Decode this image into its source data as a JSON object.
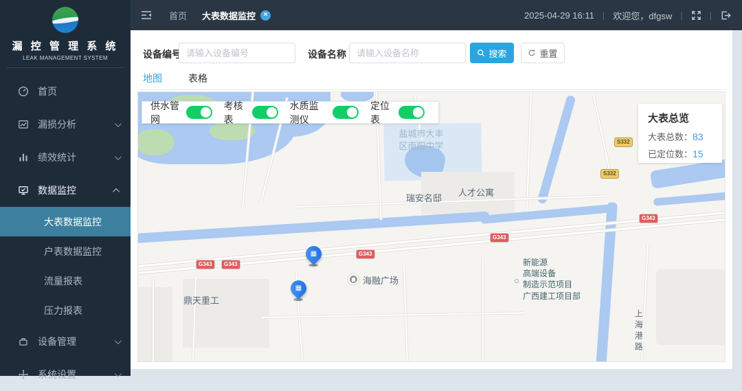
{
  "app": {
    "title": "漏 控 管 理 系 统",
    "subtitle": "LEAK MANAGEMENT SYSTEM"
  },
  "sidebar": {
    "items": [
      {
        "label": "首页"
      },
      {
        "label": "漏损分析"
      },
      {
        "label": "绩效统计"
      },
      {
        "label": "数据监控"
      },
      {
        "label": "设备管理"
      },
      {
        "label": "系统设置"
      }
    ],
    "submenu": [
      {
        "label": "大表数据监控",
        "active": true
      },
      {
        "label": "户表数据监控"
      },
      {
        "label": "流量报表"
      },
      {
        "label": "压力报表"
      }
    ]
  },
  "header": {
    "tabs": [
      {
        "label": "首页"
      },
      {
        "label": "大表数据监控",
        "active": true
      }
    ],
    "close_x": "×",
    "datetime": "2025-04-29 16:11",
    "welcome": "欢迎您，dfgsw",
    "sep": "|"
  },
  "search": {
    "fields": [
      {
        "label": "设备编号",
        "placeholder": "请输入设备编号"
      },
      {
        "label": "设备名称",
        "placeholder": "请输入设备名称"
      }
    ],
    "search_label": "搜索",
    "reset_label": "重置"
  },
  "view_tabs": [
    {
      "label": "地图",
      "active": true
    },
    {
      "label": "表格"
    }
  ],
  "map": {
    "toggles": [
      {
        "label": "供水管网",
        "on": true
      },
      {
        "label": "考核表",
        "on": true
      },
      {
        "label": "水质监测仪",
        "on": true
      },
      {
        "label": "定位表",
        "on": true
      }
    ],
    "overview": {
      "title": "大表总览",
      "rows": [
        {
          "label": "大表总数：",
          "value": "83"
        },
        {
          "label": "已定位数：",
          "value": "15"
        }
      ]
    },
    "pois": [
      {
        "text": "盐城市大丰\n区南阳中学"
      },
      {
        "text": "瑞安名邸"
      },
      {
        "text": "人才公寓"
      },
      {
        "text": "海融广场"
      },
      {
        "text": "鼎天重工"
      },
      {
        "text": "新能源\n高端设备\n制造示范项目\n广西建工项目部"
      },
      {
        "text": "上海港路"
      }
    ],
    "road_badges": [
      {
        "label": "G343"
      },
      {
        "label": "G343"
      },
      {
        "label": "G343"
      },
      {
        "label": "G343"
      },
      {
        "label": "G343"
      },
      {
        "label": "S332"
      },
      {
        "label": "S332"
      }
    ],
    "pin_glyph": "▦",
    "colors": {
      "accent_blue": "#2ba5e0",
      "toggle_green": "#13ce66",
      "value_blue": "#4596e8",
      "pin_blue": "#2e7ff0",
      "sidebar_active": "#3d7f9e"
    }
  }
}
